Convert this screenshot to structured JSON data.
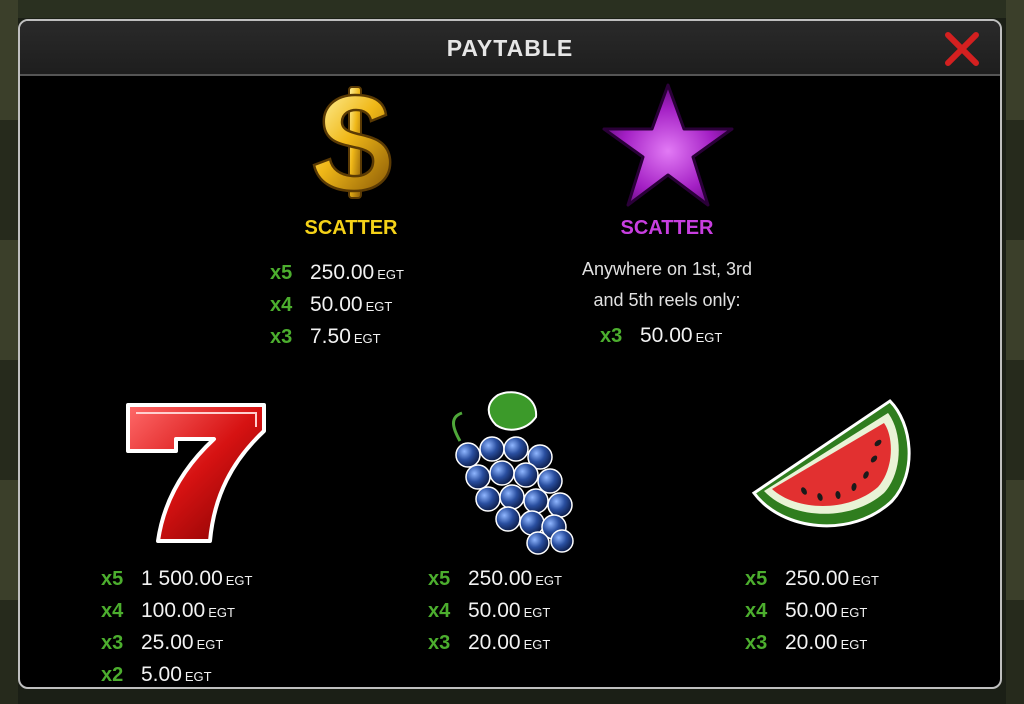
{
  "title": "PAYTABLE",
  "symbols": {
    "dollar": {
      "label": "SCATTER",
      "label_color": "#f5d218",
      "icon": "gold-dollar-icon",
      "pays": [
        {
          "mult": "x5",
          "amount": "250.00",
          "currency": "EGT"
        },
        {
          "mult": "x4",
          "amount": "50.00",
          "currency": "EGT"
        },
        {
          "mult": "x3",
          "amount": "7.50",
          "currency": "EGT"
        }
      ]
    },
    "star": {
      "label": "SCATTER",
      "label_color": "#c83ee0",
      "icon": "purple-star-icon",
      "desc1": "Anywhere on 1st, 3rd",
      "desc2": "and 5th reels only:",
      "pays": [
        {
          "mult": "x3",
          "amount": "50.00",
          "currency": "EGT"
        }
      ]
    },
    "seven": {
      "icon": "red-seven-icon",
      "pays": [
        {
          "mult": "x5",
          "amount": "1 500.00",
          "currency": "EGT"
        },
        {
          "mult": "x4",
          "amount": "100.00",
          "currency": "EGT"
        },
        {
          "mult": "x3",
          "amount": "25.00",
          "currency": "EGT"
        },
        {
          "mult": "x2",
          "amount": "5.00",
          "currency": "EGT"
        }
      ]
    },
    "grapes": {
      "icon": "grapes-icon",
      "pays": [
        {
          "mult": "x5",
          "amount": "250.00",
          "currency": "EGT"
        },
        {
          "mult": "x4",
          "amount": "50.00",
          "currency": "EGT"
        },
        {
          "mult": "x3",
          "amount": "20.00",
          "currency": "EGT"
        }
      ]
    },
    "watermelon": {
      "icon": "watermelon-icon",
      "pays": [
        {
          "mult": "x5",
          "amount": "250.00",
          "currency": "EGT"
        },
        {
          "mult": "x4",
          "amount": "50.00",
          "currency": "EGT"
        },
        {
          "mult": "x3",
          "amount": "20.00",
          "currency": "EGT"
        }
      ]
    }
  },
  "colors": {
    "multiplier": "#4cae2e",
    "close": "#d42020"
  }
}
